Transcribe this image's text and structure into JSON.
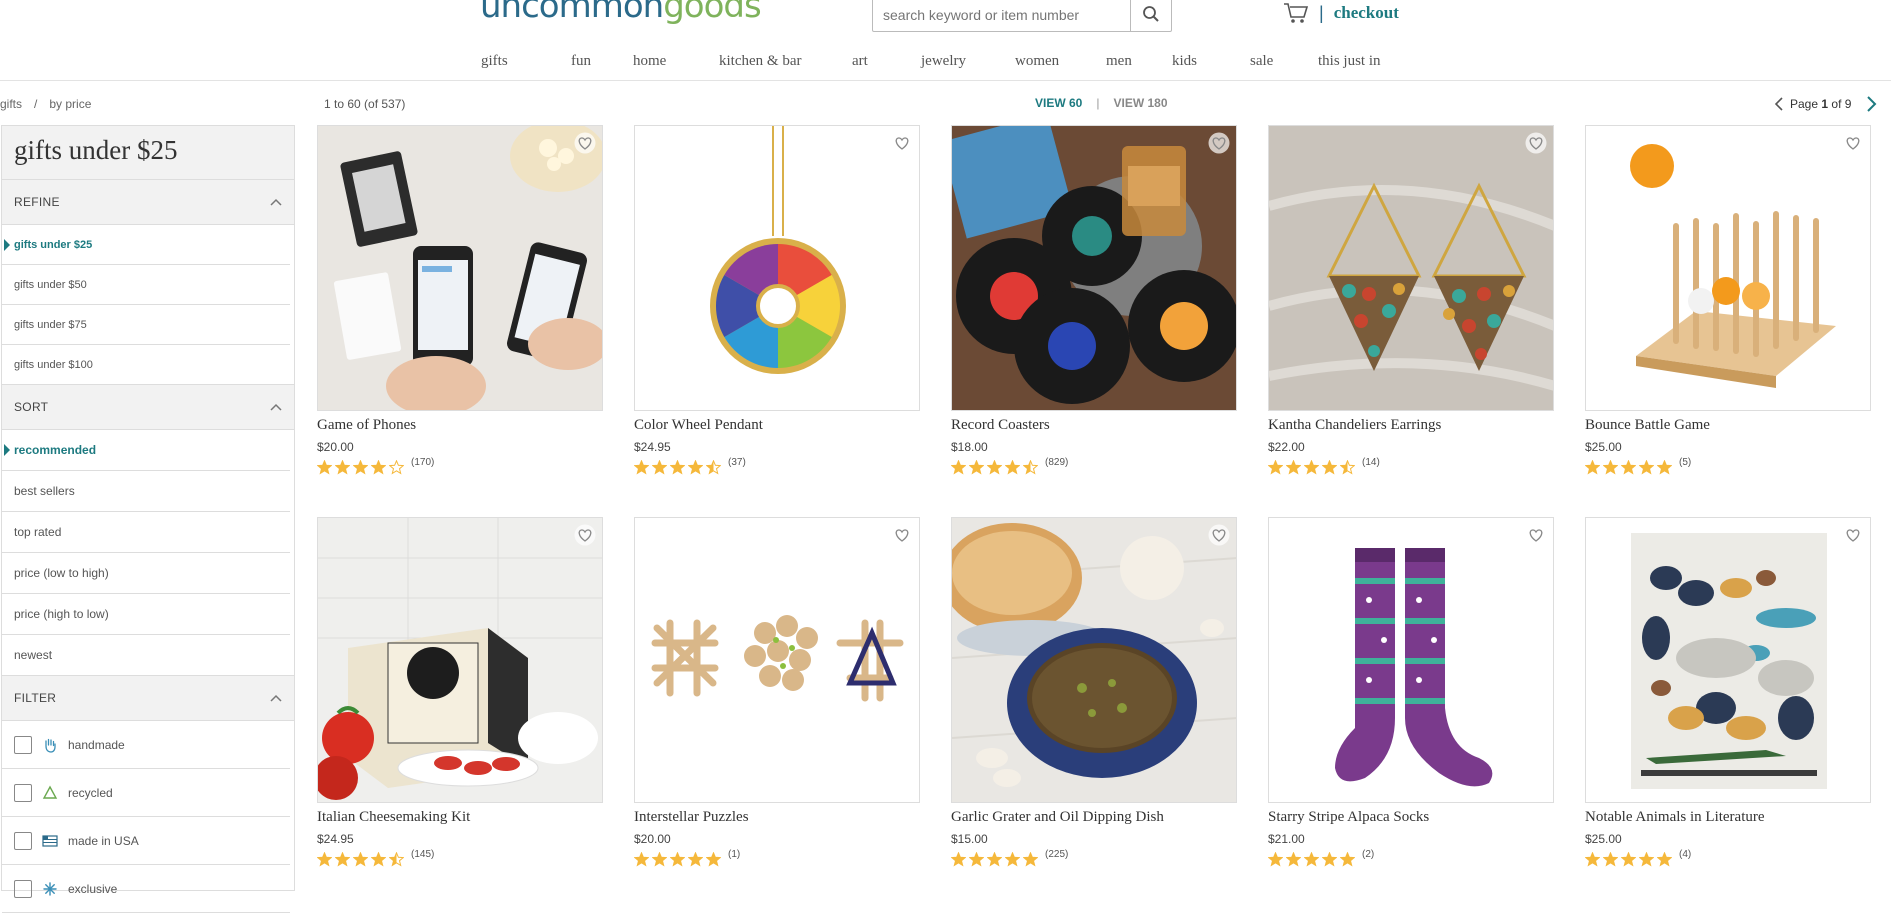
{
  "brand": {
    "part1": "uncommon",
    "part2": "goods"
  },
  "search": {
    "placeholder": "search keyword or item number"
  },
  "cart": {
    "separator": "|",
    "checkout": "checkout"
  },
  "nav": [
    "gifts",
    "fun",
    "home",
    "kitchen & bar",
    "art",
    "jewelry",
    "women",
    "men",
    "kids",
    "sale",
    "this just in"
  ],
  "breadcrumb": {
    "root": "gifts",
    "sep": "/",
    "current": "by price"
  },
  "results": {
    "range": "1 to 60 (of 537)"
  },
  "view": {
    "v60": "VIEW 60",
    "sep": "|",
    "v180": "VIEW 180"
  },
  "pagination": {
    "page_label": "Page",
    "page": "1",
    "of": "of 9"
  },
  "sidebar": {
    "title": "gifts under $25",
    "refine": {
      "label": "REFINE",
      "items": [
        "gifts under $25",
        "gifts under $50",
        "gifts under $75",
        "gifts under $100"
      ]
    },
    "sort": {
      "label": "SORT",
      "items": [
        "recommended",
        "best sellers",
        "top rated",
        "price (low to high)",
        "price (high to low)",
        "newest"
      ]
    },
    "filter": {
      "label": "FILTER",
      "items": [
        {
          "label": "handmade",
          "icon": "hand-icon"
        },
        {
          "label": "recycled",
          "icon": "recycle-icon"
        },
        {
          "label": "made in USA",
          "icon": "flag-icon"
        },
        {
          "label": "exclusive",
          "icon": "asterisk-icon"
        }
      ]
    }
  },
  "colors": {
    "teal": "#1d7a80",
    "star": "#f5b83b",
    "logo_blue": "#2b6a8a",
    "logo_green": "#7fb35c"
  },
  "products": [
    {
      "name": "Game of Phones",
      "price": "$20.00",
      "rating": 4,
      "count": "(170)"
    },
    {
      "name": "Color Wheel Pendant",
      "price": "$24.95",
      "rating": 4.5,
      "count": "(37)"
    },
    {
      "name": "Record Coasters",
      "price": "$18.00",
      "rating": 4.5,
      "count": "(829)"
    },
    {
      "name": "Kantha Chandeliers Earrings",
      "price": "$22.00",
      "rating": 4.5,
      "count": "(14)"
    },
    {
      "name": "Bounce Battle Game",
      "price": "$25.00",
      "rating": 5,
      "count": "(5)"
    },
    {
      "name": "Italian Cheesemaking Kit",
      "price": "$24.95",
      "rating": 4.5,
      "count": "(145)"
    },
    {
      "name": "Interstellar Puzzles",
      "price": "$20.00",
      "rating": 5,
      "count": "(1)"
    },
    {
      "name": "Garlic Grater and Oil Dipping Dish",
      "price": "$15.00",
      "rating": 5,
      "count": "(225)"
    },
    {
      "name": "Starry Stripe Alpaca Socks",
      "price": "$21.00",
      "rating": 5,
      "count": "(2)"
    },
    {
      "name": "Notable Animals in Literature",
      "price": "$25.00",
      "rating": 5,
      "count": "(4)"
    }
  ]
}
